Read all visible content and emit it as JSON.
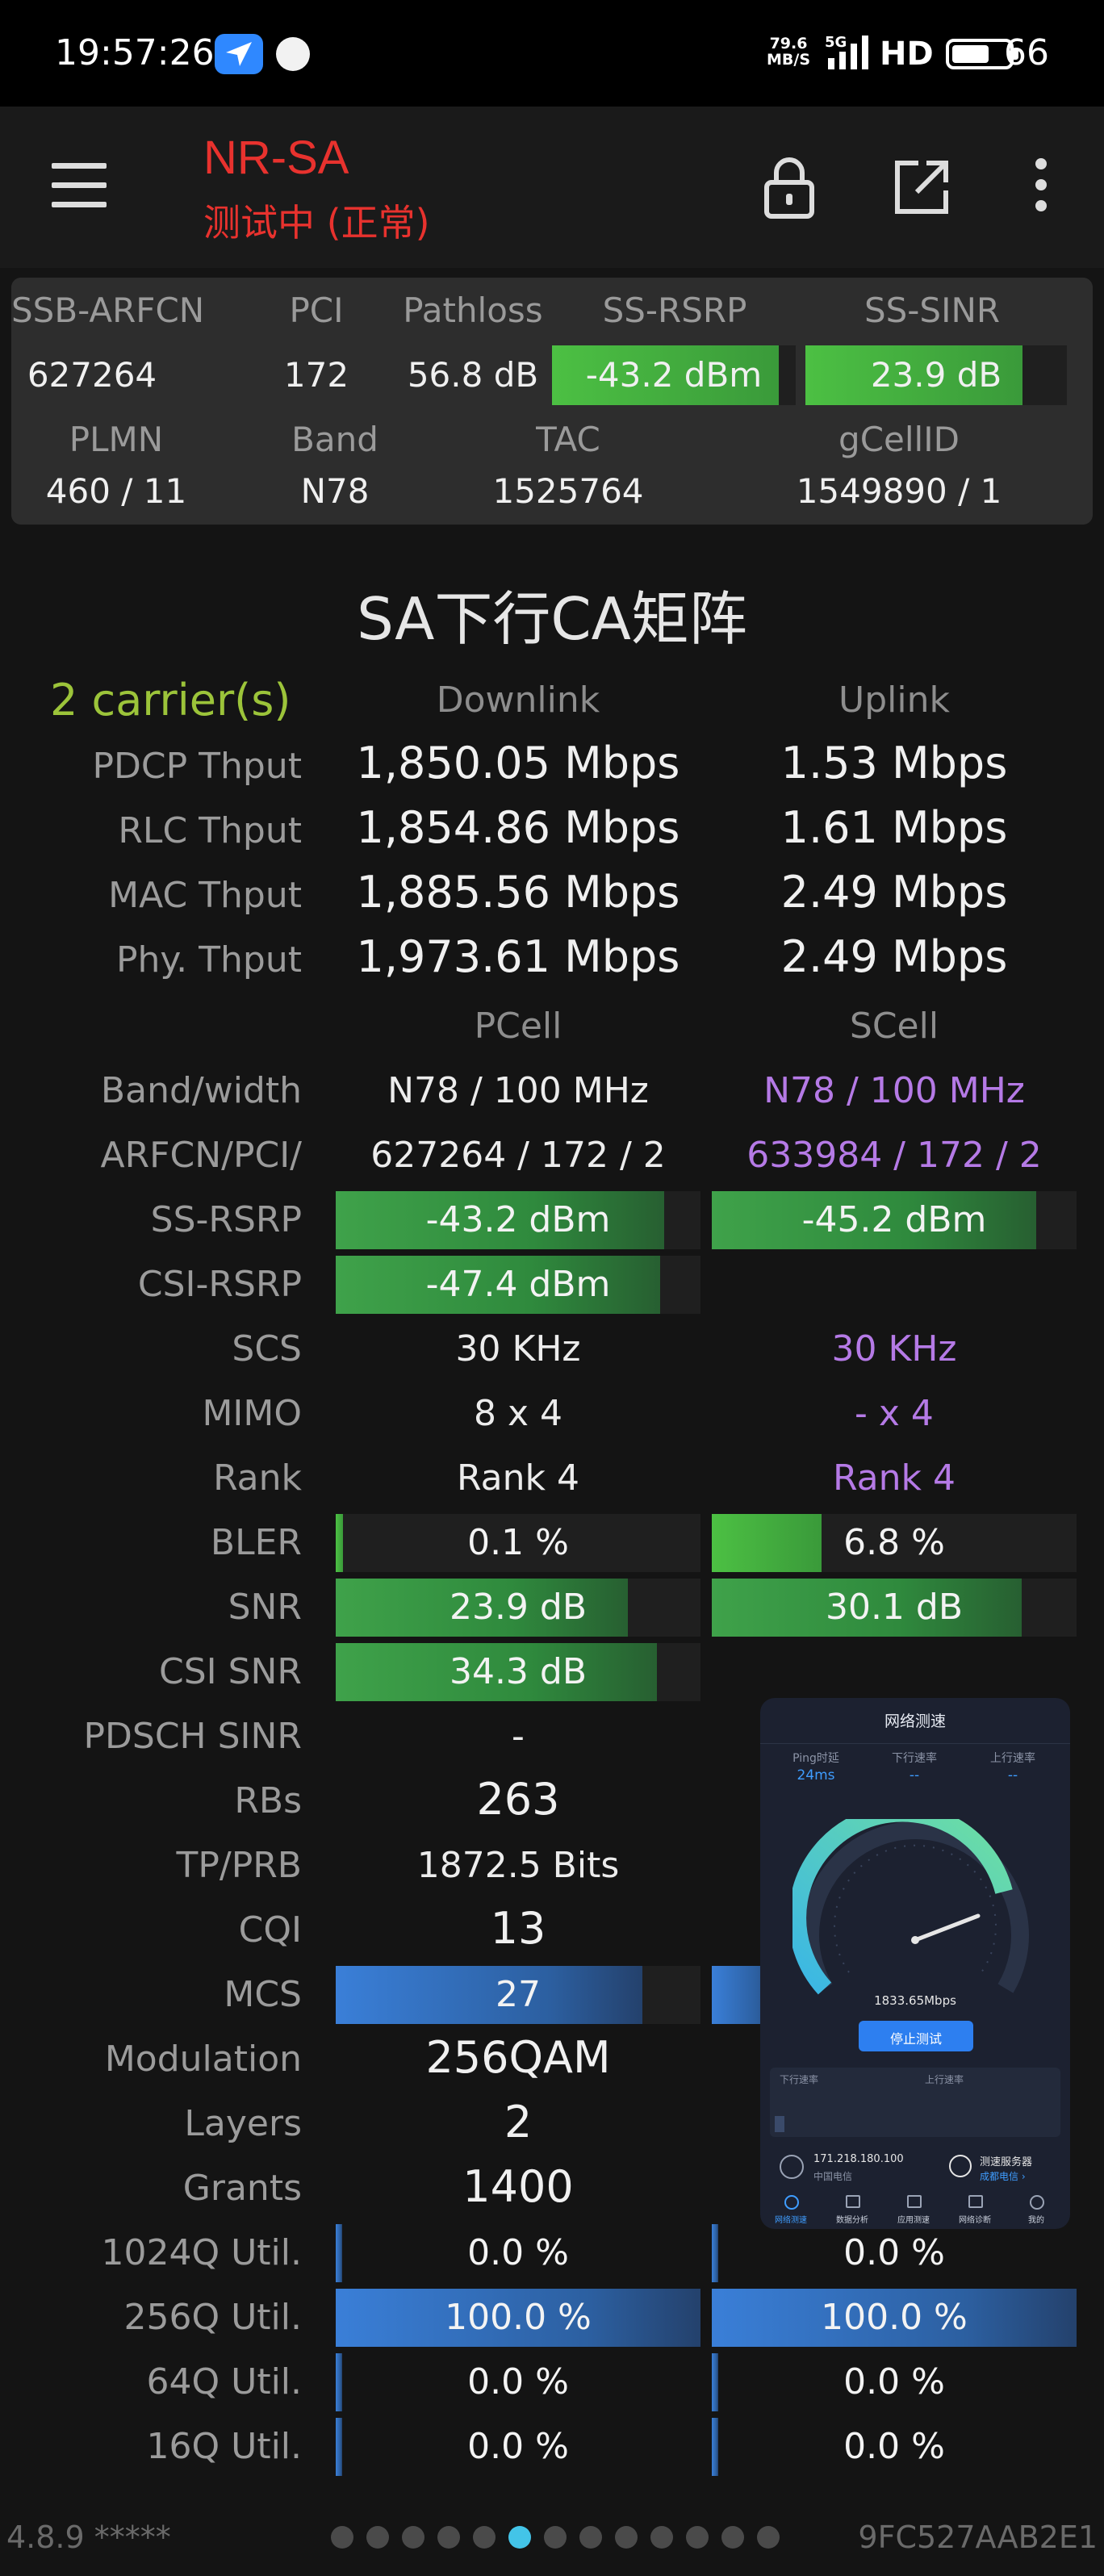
{
  "status_bar": {
    "time": "19:57:26",
    "net_speed_value": "79.6",
    "net_speed_unit": "MB/S",
    "network_type": "5G",
    "hd": "HD",
    "battery": "66",
    "battery_level": 0.66
  },
  "app_bar": {
    "title": "NR-SA",
    "subtitle": "测试中 (正常)"
  },
  "info_panel": {
    "headers1": [
      "SSB-ARFCN",
      "PCI",
      "Pathloss",
      "SS-RSRP",
      "SS-SINR"
    ],
    "values1": [
      "627264",
      "172",
      "56.8 dB",
      "-43.2 dBm",
      "23.9 dB"
    ],
    "headers2": [
      "PLMN",
      "Band",
      "TAC",
      "gCellID"
    ],
    "values2": [
      "460 / 11",
      "N78",
      "1525764",
      "1549890 / 1"
    ],
    "rsrp_level": 0.93,
    "sinr_level": 0.83
  },
  "matrix": {
    "title": "SA下行CA矩阵",
    "carriers": "2 carrier(s)",
    "downlink_header": "Downlink",
    "uplink_header": "Uplink",
    "thput_rows": [
      {
        "label": "PDCP Thput",
        "dl": "1,850.05 Mbps",
        "ul": "1.53 Mbps"
      },
      {
        "label": "RLC Thput",
        "dl": "1,854.86 Mbps",
        "ul": "1.61 Mbps"
      },
      {
        "label": "MAC Thput",
        "dl": "1,885.56 Mbps",
        "ul": "2.49 Mbps"
      },
      {
        "label": "Phy. Thput",
        "dl": "1,973.61 Mbps",
        "ul": "2.49 Mbps"
      }
    ],
    "pcell_header": "PCell",
    "scell_header": "SCell",
    "band_width": {
      "label": "Band/width",
      "pcell": "N78 / 100 MHz",
      "scell": "N78 / 100 MHz"
    },
    "arfcn_pci": {
      "label": "ARFCN/PCI/",
      "pcell": "627264 / 172 / 2",
      "scell": "633984 / 172 / 2"
    },
    "ss_rsrp": {
      "label": "SS-RSRP",
      "pcell": "-43.2 dBm",
      "scell": "-45.2 dBm",
      "pcell_level": 0.9,
      "scell_level": 0.89
    },
    "csi_rsrp": {
      "label": "CSI-RSRP",
      "pcell": "-47.4 dBm",
      "pcell_level": 0.89
    },
    "scs": {
      "label": "SCS",
      "pcell": "30 KHz",
      "scell": "30 KHz"
    },
    "mimo": {
      "label": "MIMO",
      "pcell": "8 x 4",
      "scell": "- x 4"
    },
    "rank": {
      "label": "Rank",
      "pcell": "Rank 4",
      "scell": "Rank 4"
    },
    "bler": {
      "label": "BLER",
      "pcell": "0.1 %",
      "scell": "6.8 %",
      "pcell_level": 0.02,
      "scell_level": 0.3
    },
    "snr": {
      "label": "SNR",
      "pcell": "23.9 dB",
      "scell": "30.1 dB",
      "pcell_level": 0.8,
      "scell_level": 0.85
    },
    "csi_snr": {
      "label": "CSI SNR",
      "pcell": "34.3 dB",
      "pcell_level": 0.88
    },
    "pdsch_sinr": {
      "label": "PDSCH SINR",
      "pcell": "-"
    },
    "rbs": {
      "label": "RBs",
      "pcell": "263"
    },
    "tp_prb": {
      "label": "TP/PRB",
      "pcell": "1872.5 Bits"
    },
    "cqi": {
      "label": "CQI",
      "pcell": "13"
    },
    "mcs": {
      "label": "MCS",
      "pcell": "27",
      "pcell_level": 0.84
    },
    "modulation": {
      "label": "Modulation",
      "pcell": "256QAM"
    },
    "layers": {
      "label": "Layers",
      "pcell": "2"
    },
    "grants": {
      "label": "Grants",
      "pcell": "1400"
    },
    "util_rows": [
      {
        "label": "1024Q Util.",
        "pcell": "0.0 %",
        "scell": "0.0 %",
        "pcell_level": 0.0,
        "scell_level": 0.0
      },
      {
        "label": "256Q Util.",
        "pcell": "100.0 %",
        "scell": "100.0 %",
        "pcell_level": 1.0,
        "scell_level": 1.0
      },
      {
        "label": "64Q Util.",
        "pcell": "0.0 %",
        "scell": "0.0 %",
        "pcell_level": 0.0,
        "scell_level": 0.0
      },
      {
        "label": "16Q Util.",
        "pcell": "0.0 %",
        "scell": "0.0 %",
        "pcell_level": 0.0,
        "scell_level": 0.0
      }
    ]
  },
  "speedtest_overlay": {
    "title": "网络测速",
    "ping_label": "Ping时延",
    "ping_value": "24ms",
    "dl_label": "下行速率",
    "dl_value": "--",
    "ul_label": "上行速率",
    "ul_value": "--",
    "gauge_value": "1833.65Mbps",
    "stop_button": "停止测试",
    "dl_chart_label": "下行速率",
    "ul_chart_label": "上行速率",
    "ip": "171.218.180.100",
    "isp": "中国电信",
    "server_label": "测速服务器",
    "server_name": "成都电信 ›",
    "tabs": [
      "网络测速",
      "数据分析",
      "应用测速",
      "网络诊断",
      "我的"
    ]
  },
  "footer": {
    "version": "4.8.9 *****",
    "device_id": "9FC527AAB2E1",
    "page_count": 13,
    "active_page": 5
  },
  "colors": {
    "title_red": "#e8322e",
    "green_bar": "#3fa24a",
    "blue_bar": "#3a7fd8",
    "scell_purple": "#b57ae6",
    "carrier_green": "#9cc43a",
    "active_dot": "#43c4e8"
  }
}
